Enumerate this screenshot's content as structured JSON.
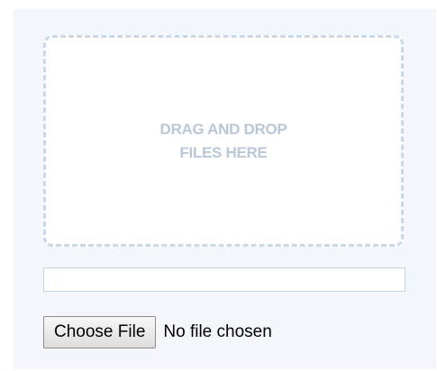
{
  "drop_zone": {
    "line1": "DRAG AND DROP",
    "line2": "FILES HERE"
  },
  "progress": {
    "value_percent": 0
  },
  "file_input": {
    "button_label": "Choose File",
    "status_text": "No file chosen"
  },
  "colors": {
    "panel_background": "#f3f7fb",
    "drop_border": "#c9d8e6",
    "drop_text": "#b9c7d6",
    "progress_border": "#c3d3e2"
  }
}
